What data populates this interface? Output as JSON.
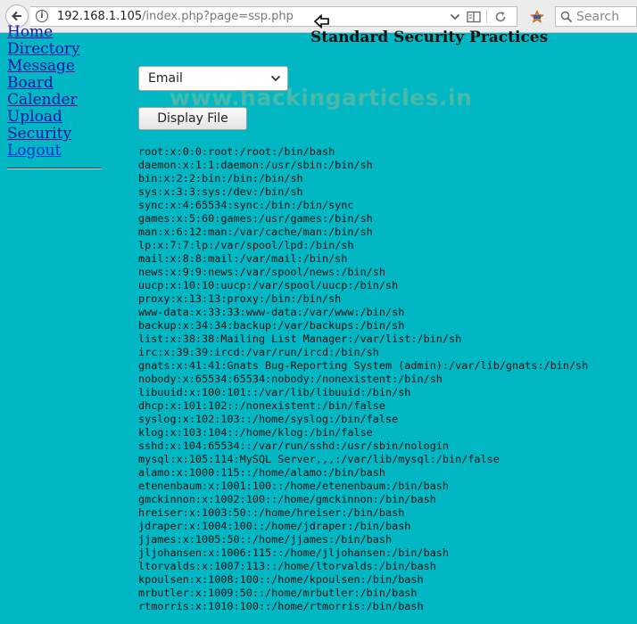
{
  "browser": {
    "url_host": "192.168.1.105",
    "url_path": "/index.php?page=ssp.php",
    "search_placeholder": "Search"
  },
  "nav": {
    "items": [
      {
        "label": "Home"
      },
      {
        "label": "Directory"
      },
      {
        "label": "Message"
      },
      {
        "label": "Board"
      },
      {
        "label": "Calender"
      },
      {
        "label": "Upload"
      },
      {
        "label": "Security"
      },
      {
        "label": "Logout"
      }
    ]
  },
  "main": {
    "title": "Standard Security Practices",
    "watermark": "www.hackingarticles.in",
    "file_select": {
      "value": "Email"
    },
    "display_button": "Display File",
    "output_lines": [
      "root:x:0:0:root:/root:/bin/bash",
      "daemon:x:1:1:daemon:/usr/sbin:/bin/sh",
      "bin:x:2:2:bin:/bin:/bin/sh",
      "sys:x:3:3:sys:/dev:/bin/sh",
      "sync:x:4:65534:sync:/bin:/bin/sync",
      "games:x:5:60:games:/usr/games:/bin/sh",
      "man:x:6:12:man:/var/cache/man:/bin/sh",
      "lp:x:7:7:lp:/var/spool/lpd:/bin/sh",
      "mail:x:8:8:mail:/var/mail:/bin/sh",
      "news:x:9:9:news:/var/spool/news:/bin/sh",
      "uucp:x:10:10:uucp:/var/spool/uucp:/bin/sh",
      "proxy:x:13:13:proxy:/bin:/bin/sh",
      "www-data:x:33:33:www-data:/var/www:/bin/sh",
      "backup:x:34:34:backup:/var/backups:/bin/sh",
      "list:x:38:38:Mailing List Manager:/var/list:/bin/sh",
      "irc:x:39:39:ircd:/var/run/ircd:/bin/sh",
      "gnats:x:41:41:Gnats Bug-Reporting System (admin):/var/lib/gnats:/bin/sh",
      "nobody:x:65534:65534:nobody:/nonexistent:/bin/sh",
      "libuuid:x:100:101::/var/lib/libuuid:/bin/sh",
      "dhcp:x:101:102::/nonexistent:/bin/false",
      "syslog:x:102:103::/home/syslog:/bin/false",
      "klog:x:103:104::/home/klog:/bin/false",
      "sshd:x:104:65534::/var/run/sshd:/usr/sbin/nologin",
      "mysql:x:105:114:MySQL Server,,,:/var/lib/mysql:/bin/false",
      "alamo:x:1000:115::/home/alamo:/bin/bash",
      "etenenbaum:x:1001:100::/home/etenenbaum:/bin/bash",
      "gmckinnon:x:1002:100::/home/gmckinnon:/bin/bash",
      "hreiser:x:1003:50::/home/hreiser:/bin/bash",
      "jdraper:x:1004:100::/home/jdraper:/bin/bash",
      "jjames:x:1005:50::/home/jjames:/bin/bash",
      "jljohansen:x:1006:115::/home/jljohansen:/bin/bash",
      "ltorvalds:x:1007:113::/home/ltorvalds:/bin/bash",
      "kpoulsen:x:1008:100::/home/kpoulsen:/bin/bash",
      "mrbutler:x:1009:50::/home/mrbutler:/bin/bash",
      "rtmorris:x:1010:100::/home/rtmorris:/bin/bash"
    ]
  },
  "colors": {
    "page_background": "#00b7c3",
    "link": "#1a12a6"
  },
  "icons": [
    "back-arrow-icon",
    "info-icon",
    "chevron-down-icon",
    "reader-view-icon",
    "reload-icon",
    "extension-icon",
    "search-icon",
    "cursor-pointer-icon"
  ]
}
